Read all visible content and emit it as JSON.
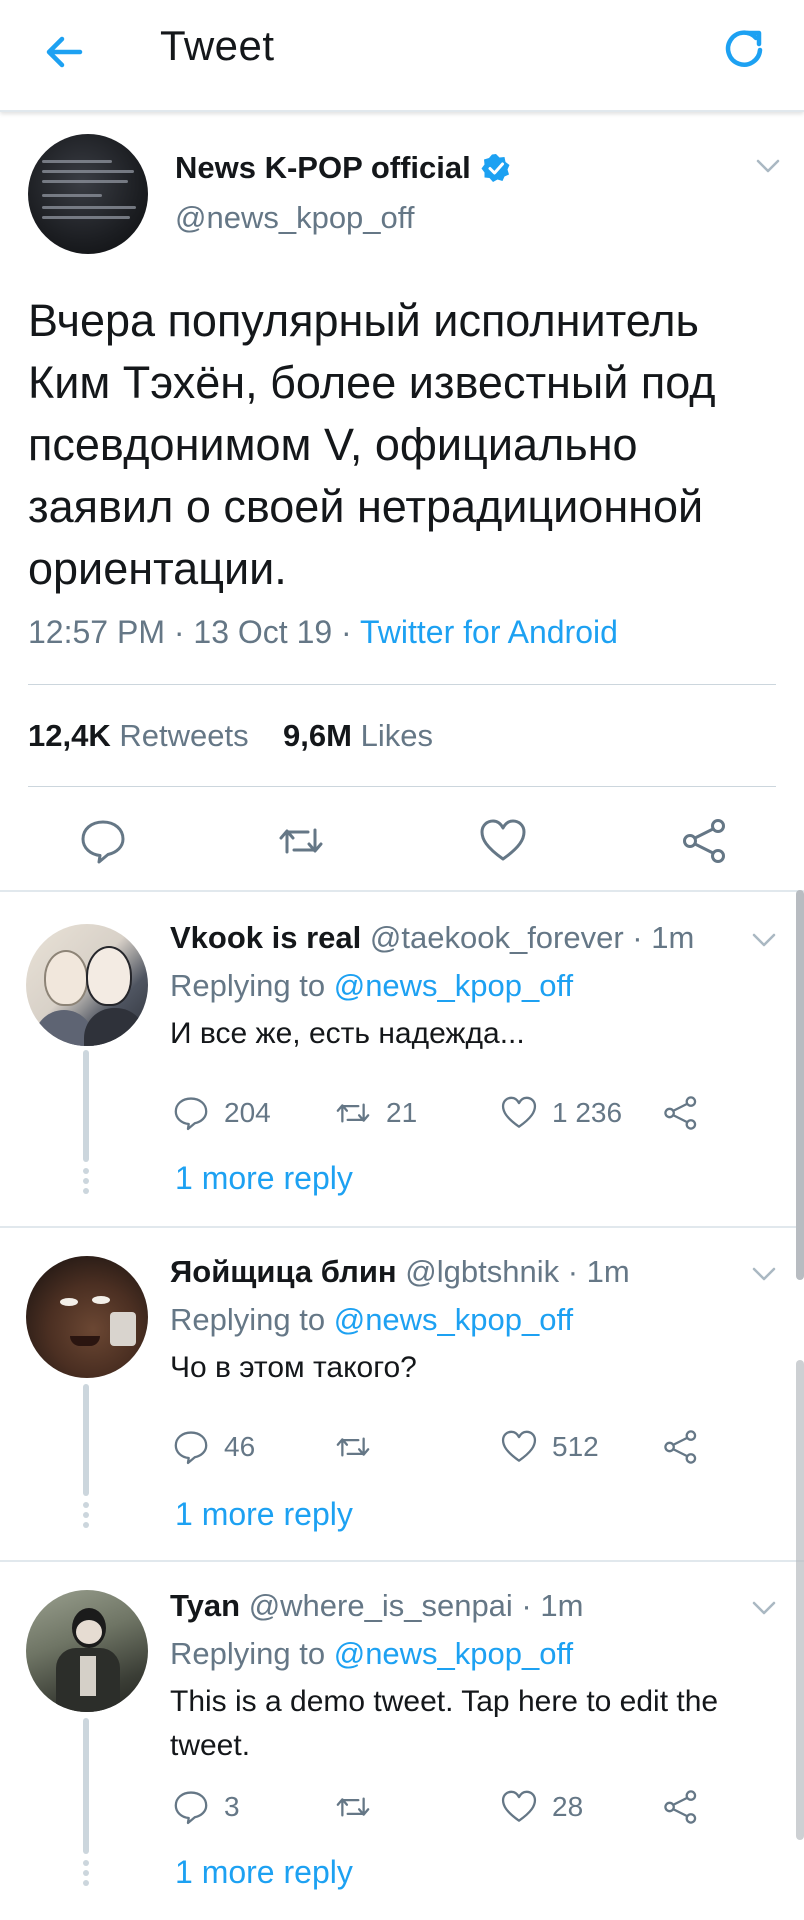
{
  "header": {
    "title": "Tweet",
    "back_icon": "arrow-left-icon",
    "refresh_icon": "refresh-icon",
    "accent_color": "#1da1f2"
  },
  "main_tweet": {
    "author_name": "News K-POP official",
    "handle": "@news_kpop_off",
    "verified": true,
    "text": "Вчера популярный исполнитель Ким Тэхён, более известный под псевдонимом V, официально заявил о своей нетрадиционной ориентации.",
    "time": "12:57 PM · 13 Oct 19 · ",
    "source": "Twitter for Android",
    "retweets_count": "12,4K",
    "retweets_label": "Retweets",
    "likes_count": "9,6M",
    "likes_label": "Likes"
  },
  "replies": [
    {
      "name": "Vkook is real",
      "handle_time": "@taekook_forever · 1m",
      "replying_prefix": "Replying to ",
      "replying_to": "@news_kpop_off",
      "text": "И все же, есть надежда...",
      "reply_count": "204",
      "retweet_count": "21",
      "like_count": "1 236",
      "more_replies": "1 more reply"
    },
    {
      "name": "Яойщица блин",
      "handle_time": "@lgbtshnik · 1m",
      "replying_prefix": "Replying to ",
      "replying_to": "@news_kpop_off",
      "text": "Чо в этом такого?",
      "reply_count": "46",
      "retweet_count": "",
      "like_count": "512",
      "more_replies": "1 more reply"
    },
    {
      "name": "Tyan",
      "handle_time": "@where_is_senpai · 1m",
      "replying_prefix": "Replying to ",
      "replying_to": "@news_kpop_off",
      "text": "This is a demo tweet. Tap here to edit the tweet.",
      "reply_count": "3",
      "retweet_count": "",
      "like_count": "28",
      "more_replies": "1 more reply"
    }
  ]
}
